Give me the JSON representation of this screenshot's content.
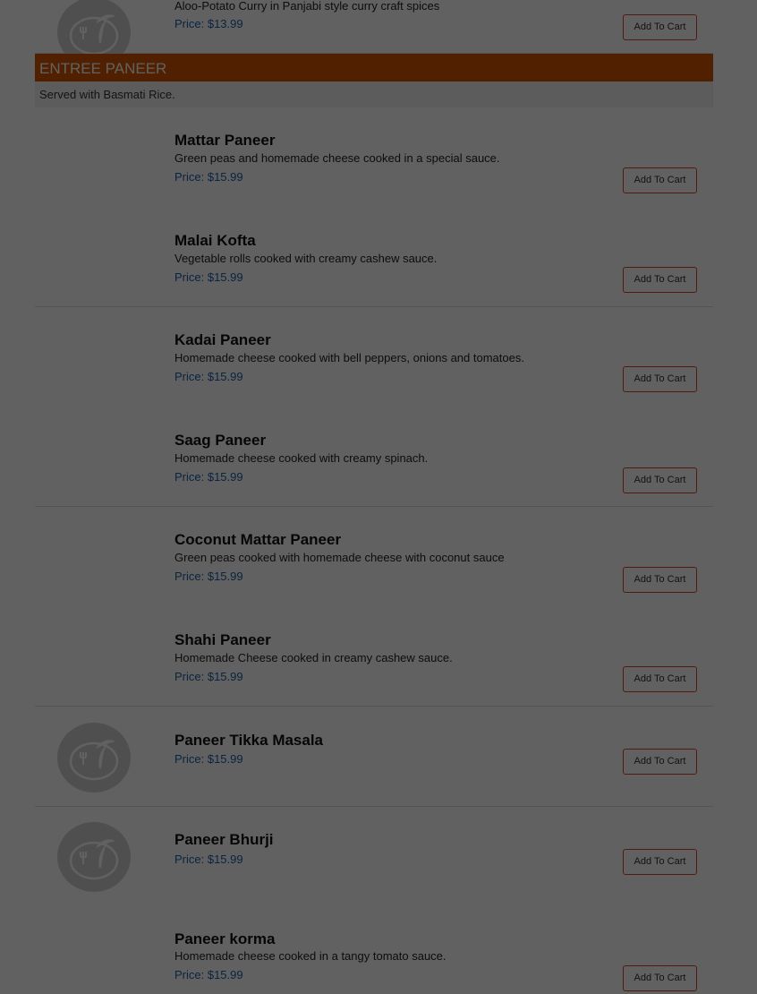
{
  "top_item": {
    "desc": "Aloo-Potato Curry in Panjabi style curry craft spices",
    "price": "Price: $13.99",
    "cart_label": "Add To Cart"
  },
  "section": {
    "title": "ENTREE PANEER",
    "subtitle": "Served with Basmati Rice."
  },
  "items": [
    {
      "name": "Mattar Paneer",
      "desc": "Green peas and homemade cheese cooked in a special sauce.",
      "price": "Price: $15.99",
      "cart_label": "Add To Cart"
    },
    {
      "name": "Malai Kofta",
      "desc": "Vegetable rolls cooked with creamy cashew sauce.",
      "price": "Price: $15.99",
      "cart_label": "Add To Cart"
    },
    {
      "name": "Kadai Paneer",
      "desc": "Homemade cheese cooked with bell peppers, onions and tomatoes.",
      "price": "Price: $15.99",
      "cart_label": "Add To Cart"
    },
    {
      "name": "Saag Paneer",
      "desc": "Homemade cheese cooked with creamy spinach.",
      "price": "Price: $15.99",
      "cart_label": "Add To Cart"
    },
    {
      "name": "Coconut Mattar Paneer",
      "desc": "Green peas cooked with homemade cheese with coconut sauce",
      "price": "Price: $15.99",
      "cart_label": "Add To Cart"
    },
    {
      "name": "Shahi Paneer",
      "desc": "Homemade Cheese cooked in creamy cashew sauce.",
      "price": "Price: $15.99",
      "cart_label": "Add To Cart"
    },
    {
      "name": "Paneer Tikka Masala",
      "price": "Price: $15.99",
      "cart_label": "Add To Cart"
    },
    {
      "name": "Paneer Bhurji",
      "price": "Price: $15.99",
      "cart_label": "Add To Cart"
    },
    {
      "name": "Paneer korma",
      "desc": "Homemade cheese cooked in a tangy tomato sauce.",
      "price": "Price: $15.99",
      "cart_label": "Add To Cart"
    }
  ]
}
